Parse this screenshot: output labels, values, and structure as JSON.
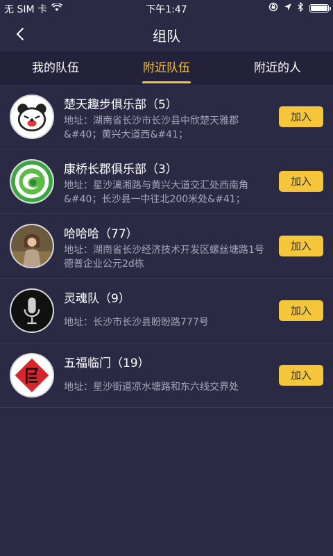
{
  "status": {
    "carrier": "无 SIM 卡",
    "time": "下午1:47"
  },
  "nav": {
    "title": "组队"
  },
  "tabs": [
    {
      "label": "我的队伍",
      "active": false
    },
    {
      "label": "附近队伍",
      "active": true
    },
    {
      "label": "附近的人",
      "active": false
    }
  ],
  "teams": [
    {
      "name": "楚天趣步俱乐部（5）",
      "address": "地址：湖南省长沙市长沙县中欣楚天雅郡&#40；黄兴大道西&#41；",
      "join": "加入"
    },
    {
      "name": "康桥长郡俱乐部（3）",
      "address": "地址：星沙漓湘路与黄兴大道交汇处西南角&#40；长沙县一中往北200米处&#41；",
      "join": "加入"
    },
    {
      "name": "哈哈哈（77）",
      "address": "地址：湖南省长沙经济技术开发区螺丝塘路1号德普企业公元2d栋",
      "join": "加入"
    },
    {
      "name": "灵魂队（9）",
      "address": "地址：长沙市长沙县盼盼路777号",
      "join": "加入"
    },
    {
      "name": "五福临门（19）",
      "address": "地址：星沙街道凉水塘路和东六线交界处",
      "join": "加入"
    }
  ],
  "colors": {
    "background": "#2b2a45",
    "tabbar": "#23223a",
    "accent": "#f5c63a",
    "secondary_text": "#a7a6b8"
  }
}
